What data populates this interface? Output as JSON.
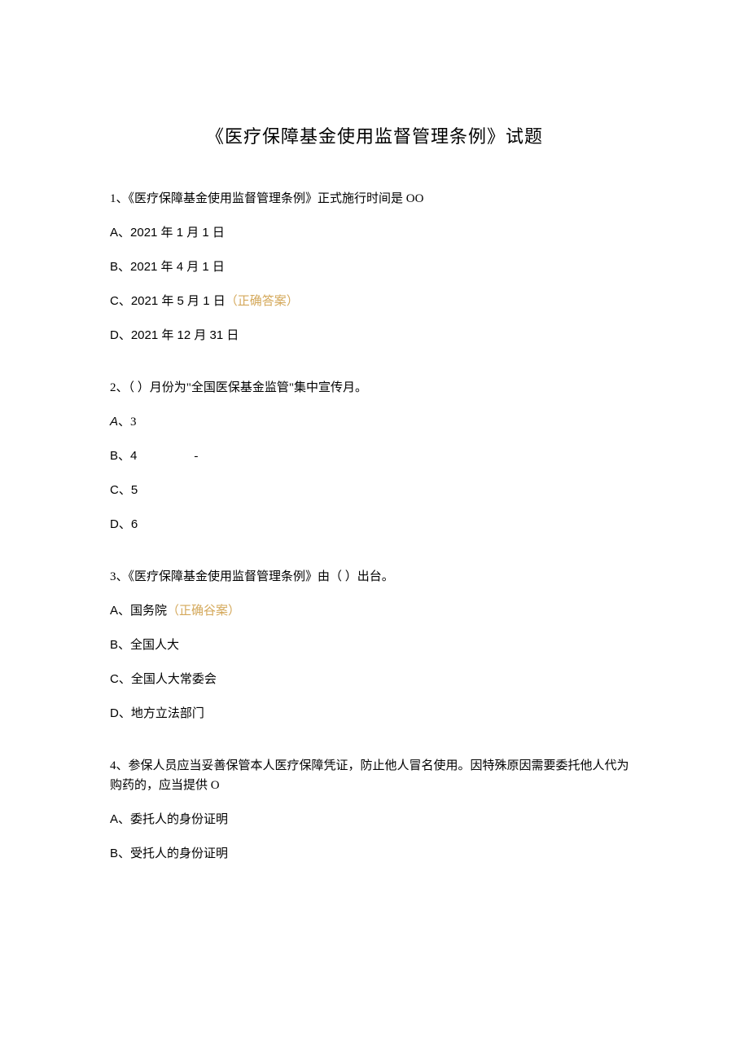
{
  "title": "《医疗保障基金使用监督管理条例》试题",
  "q1": {
    "text": "1、《医疗保障基金使用监督管理条例》正式施行时间是 OO",
    "a": "A、2021 年 1 月 1 日",
    "b": "B、2021 年 4 月 1 日",
    "c_prefix": "C、2021 年 5 月 1 日",
    "c_answer": "（正确答案）",
    "d": "D、2021 年 12 月 31 日"
  },
  "q2": {
    "text": "2、（ ）月份为\"全国医保基金监管\"集中宣传月。",
    "a_prefix": "A",
    "a_rest": "、3",
    "b": "B、4",
    "b_dash": "-",
    "c": "C、5",
    "d": "D、6"
  },
  "q3": {
    "text": "3、《医疗保障基金使用监督管理条例》由（ ）出台。",
    "a_prefix": "A、国务院",
    "a_answer": "（正确谷案）",
    "b": "B、全国人大",
    "c": "C、全国人大常委会",
    "d": "D、地方立法部门"
  },
  "q4": {
    "text": "4、参保人员应当妥善保管本人医疗保障凭证，防止他人冒名使用。因特殊原因需要委托他人代为购药的，应当提供 O",
    "a": "A、委托人的身份证明",
    "b": "B、受托人的身份证明"
  }
}
